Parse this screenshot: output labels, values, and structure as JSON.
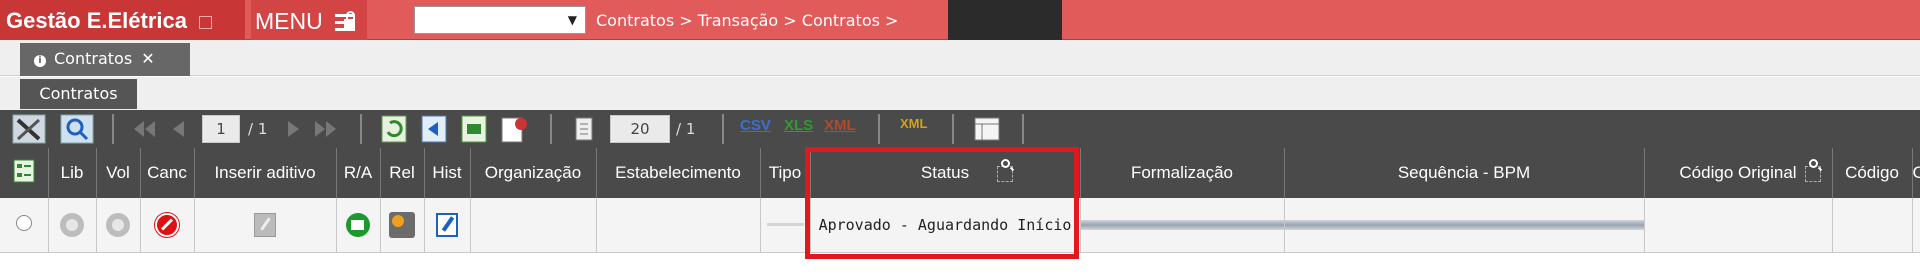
{
  "app": {
    "title": "Gestão E.Elétrica",
    "menu_label": "MENU",
    "select_value": "",
    "breadcrumb": "Contratos > Transação > Contratos >"
  },
  "tabs": {
    "page_tab_label": "Contratos",
    "page_tab_close": "✕",
    "sub_tab_label": "Contratos"
  },
  "toolbar": {
    "page_current": "1",
    "page_total": "/ 1",
    "rows_per_page": "20",
    "rows_total": "/ 1",
    "export_csv": "CSV",
    "export_xls": "XLS",
    "export_xml": "XML",
    "import_xml": "XML"
  },
  "grid": {
    "columns": [
      "",
      "Lib",
      "Vol",
      "Canc",
      "Inserir aditivo",
      "R/A",
      "Rel",
      "Hist",
      "Organização",
      "Estabelecimento",
      "Tipo",
      "Status",
      "Formalização",
      "Sequência - BPM",
      "Código Original",
      "Código",
      "C"
    ],
    "row": {
      "organizacao": "",
      "estabelecimento": "",
      "status": "Aprovado - Aguardando Início",
      "formalizacao": "",
      "codigo_original": "",
      "codigo": ""
    }
  },
  "colors": {
    "top_bar": "#e15b5b",
    "brand": "#c93636",
    "toolbar": "#4a4a4a",
    "highlight": "#e0191d"
  }
}
